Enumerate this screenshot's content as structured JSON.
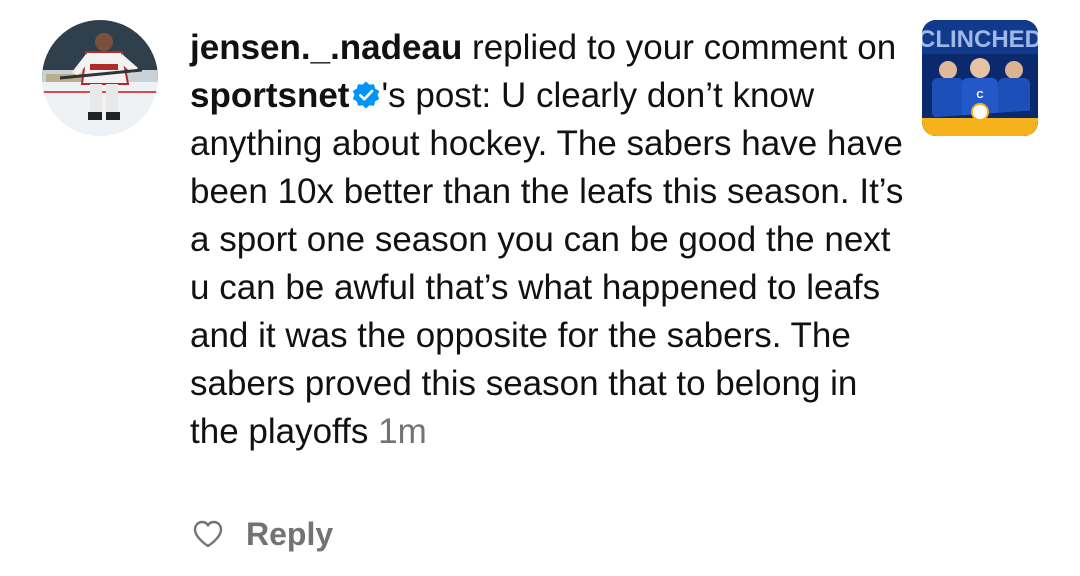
{
  "notification": {
    "username": "jensen._.nadeau",
    "action_text": " replied to your comment on ",
    "account": "sportsnet",
    "after_account": "'s post: U clearly don’t know anything about hockey. The sabers have have been 10x better than the leafs this season. It’s a sport one season you can be good the next u can be awful that’s what happened to leafs and it was the opposite for the sabers. The sabers proved this season that to belong in the playoffs",
    "timestamp": "1m"
  },
  "actions": {
    "like_icon": "heart-outline-icon",
    "reply_label": "Reply"
  },
  "thumbnail": {
    "banner_text": "CLINCHED"
  },
  "colors": {
    "text": "#111111",
    "muted": "#737373",
    "verified_badge": "#0095f6",
    "thumbnail_bg": "#0b2a6e",
    "thumbnail_accent": "#f5b21a"
  }
}
